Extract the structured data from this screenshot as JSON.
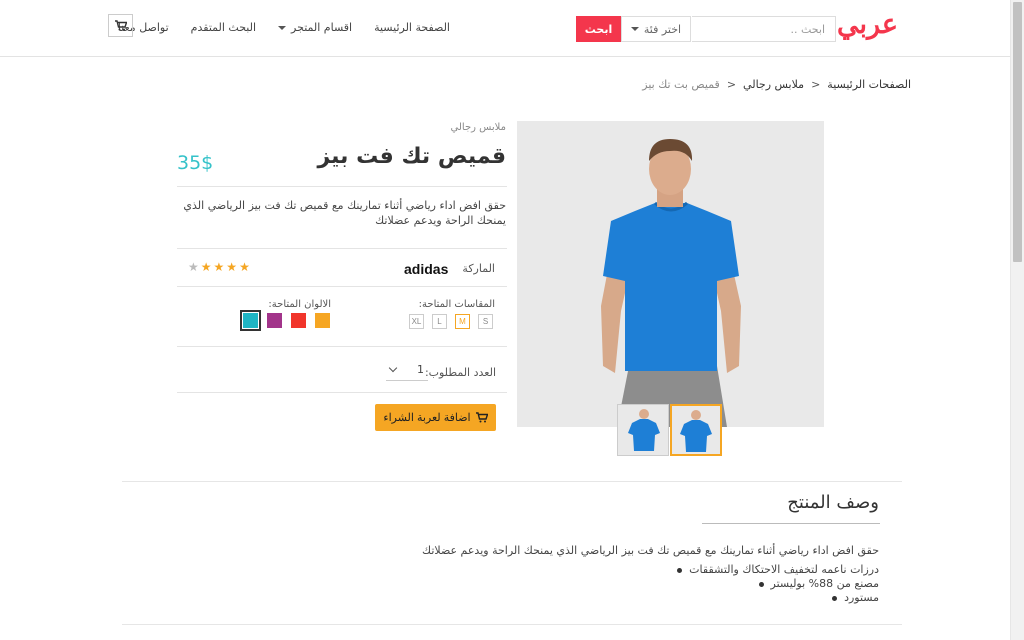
{
  "header": {
    "logo": "عربي",
    "search_placeholder": "ابحث ..",
    "category_select": "اختر فئة",
    "search_button": "ابحث",
    "nav": [
      "الصفحة الرئيسية",
      "اقسام المتجر",
      "البحث المتقدم",
      "تواصل معنا"
    ]
  },
  "breadcrumb": [
    "الصفحات الرئيسية",
    "ملابس رجالي",
    "قميص بت تك بيز"
  ],
  "product": {
    "category": "ملابس رجالي",
    "title": "قميص تك فت بيز",
    "price": "35$",
    "description": "حقق افض اداء رياضي أثناء تمارينك مع قميص تك فت بيز الرياضي الذي يمنحك الراحة ويدعم عضلاتك",
    "brand_label": "الماركة",
    "brand_logo": "adidas",
    "rating": 4,
    "rating_max": 5,
    "sizes_label": "المقاسات المتاحة:",
    "sizes": [
      "XL",
      "L",
      "M",
      "S"
    ],
    "selected_size": "M",
    "colors_label": "الالوان المتاحة:",
    "colors": [
      "#1fb5c4",
      "#a2348a",
      "#f1352b",
      "#f6a623"
    ],
    "selected_color": "#1fb5c4",
    "qty_label": "العدد المطلوب:",
    "qty": "1",
    "add_to_cart": "اضافة لعربة الشراء"
  },
  "description_section": {
    "title": "وصف المنتج",
    "text": "حقق افض اداء رياضي أثناء تمارينك مع قميص تك فت بيز الرياضي الذي يمنحك الراحة ويدعم عضلاتك",
    "features": [
      "درزات ناعمه لتخفيف الاحتكاك والتشققات",
      "مصنع من 88% بوليستر",
      "مستورد"
    ]
  },
  "icons": {
    "cart": "cart-icon",
    "caret": "caret-down-icon",
    "star": "star-icon"
  }
}
